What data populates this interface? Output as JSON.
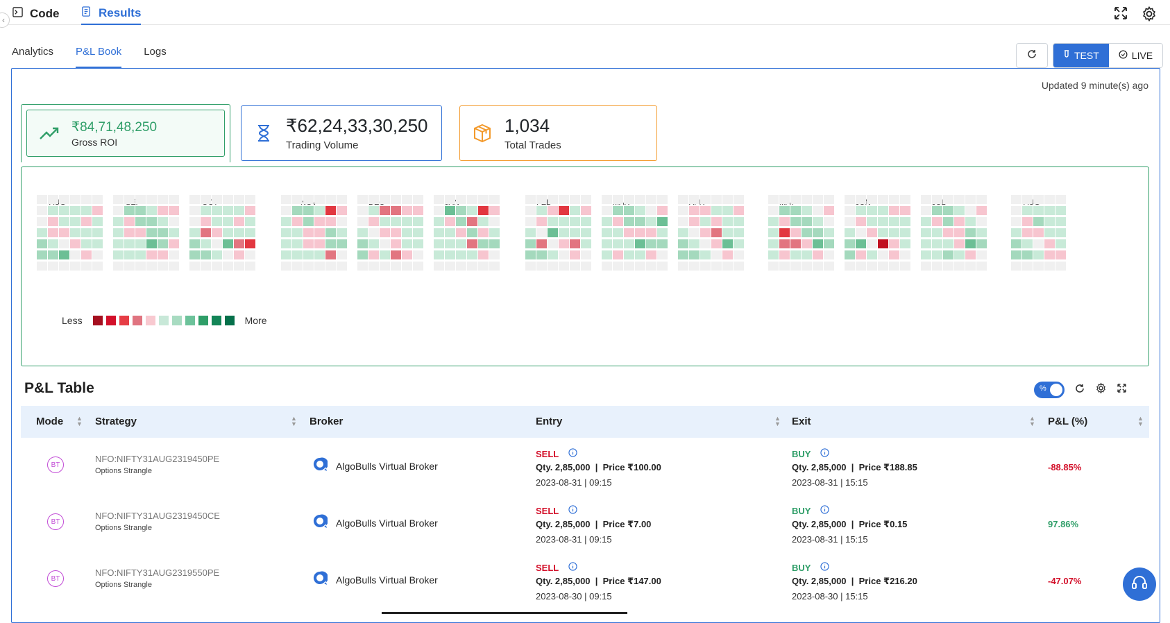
{
  "top_tabs": [
    {
      "label": "Code",
      "icon": "terminal-icon"
    },
    {
      "label": "Results",
      "icon": "report-icon"
    }
  ],
  "sub_tabs": [
    "Analytics",
    "P&L Book",
    "Logs"
  ],
  "mode": {
    "test_label": "TEST",
    "live_label": "LIVE"
  },
  "updated_text": "Updated 9 minute(s) ago",
  "stats": {
    "gross_roi": {
      "value": "₹84,71,48,250",
      "label": "Gross ROI"
    },
    "trading_volume": {
      "value": "₹62,24,33,30,250",
      "label": "Trading Volume"
    },
    "total_trades": {
      "value": "1,034",
      "label": "Total Trades"
    }
  },
  "heatmap": {
    "months": [
      "AUG",
      "SEP",
      "OCT",
      "NOV",
      "DEC",
      "JAN",
      "FEB",
      "MAR",
      "APR",
      "MAY",
      "JUN",
      "JUL",
      "AUG"
    ],
    "legend_less": "Less",
    "legend_more": "More",
    "legend_colors": [
      "#a50f1f",
      "#d3102a",
      "#e63d45",
      "#e07480",
      "#f8c9d0",
      "#c8e8d8",
      "#a8dbc1",
      "#6cc29a",
      "#2f9e68",
      "#138557",
      "#05704a"
    ],
    "colors": {
      "empty": "#f0f0f0",
      "green_light": "#c8ead8",
      "green_mid": "#a4d9bd",
      "green_dark": "#6cbf95",
      "pink": "#f7c5cf",
      "red_mid": "#e27580",
      "red": "#e23740",
      "red_dark": "#c10f20"
    }
  },
  "pnl_table": {
    "title": "P&L Table",
    "toggle_label": "%",
    "columns": [
      "Mode",
      "Strategy",
      "Broker",
      "Entry",
      "Exit",
      "P&L (%)"
    ],
    "rows": [
      {
        "mode": "BT",
        "symbol": "NFO:NIFTY31AUG2319450PE",
        "strategy": "Options Strangle",
        "broker": "AlgoBulls Virtual Broker",
        "entry": {
          "side": "SELL",
          "qty": "Qty. 2,85,000",
          "price": "Price ₹100.00",
          "ts": "2023-08-31 | 09:15"
        },
        "exit": {
          "side": "BUY",
          "qty": "Qty. 2,85,000",
          "price": "Price ₹188.85",
          "ts": "2023-08-31 | 15:15"
        },
        "pnl": "-88.85%"
      },
      {
        "mode": "BT",
        "symbol": "NFO:NIFTY31AUG2319450CE",
        "strategy": "Options Strangle",
        "broker": "AlgoBulls Virtual Broker",
        "entry": {
          "side": "SELL",
          "qty": "Qty. 2,85,000",
          "price": "Price ₹7.00",
          "ts": "2023-08-31 | 09:15"
        },
        "exit": {
          "side": "BUY",
          "qty": "Qty. 2,85,000",
          "price": "Price ₹0.15",
          "ts": "2023-08-31 | 15:15"
        },
        "pnl": "97.86%"
      },
      {
        "mode": "BT",
        "symbol": "NFO:NIFTY31AUG2319550PE",
        "strategy": "Options Strangle",
        "broker": "AlgoBulls Virtual Broker",
        "entry": {
          "side": "SELL",
          "qty": "Qty. 2,85,000",
          "price": "Price ₹147.00",
          "ts": "2023-08-30 | 09:15"
        },
        "exit": {
          "side": "BUY",
          "qty": "Qty. 2,85,000",
          "price": "Price ₹216.20",
          "ts": "2023-08-30 | 15:15"
        },
        "pnl": "-47.07%"
      }
    ]
  }
}
